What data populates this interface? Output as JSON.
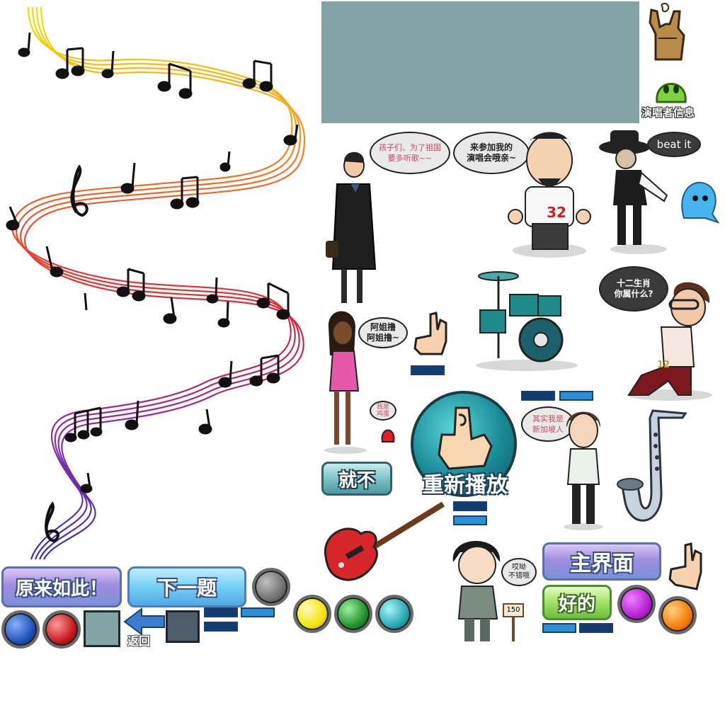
{
  "texts": {
    "singer_info": "演唱者信息",
    "bubble_host": "孩子们、为了祖国\n要多听歌~~",
    "bubble_fan": "来参加我的\n演唱会哦亲~",
    "bubble_beat": "beat it",
    "bubble_zodiac": "十二生肖\n你属什么?",
    "bubble_sister": "阿姐撸\n阿姐撸~",
    "bubble_small": "我是\n鸡蛋",
    "bubble_singapore": "其实我是\n新加坡人",
    "bubble_good": "哎呦\n不错哦",
    "shirt_number": "32",
    "sign_150": "150",
    "jacket_number": "12"
  },
  "buttons": {
    "yuanlai": "原来如此！",
    "next": "下一题",
    "back": "返回",
    "jiubu": "就不",
    "replay": "重新播放",
    "main": "主界面",
    "ok": "好的"
  },
  "colors": {
    "teal_panel": "#83a3a7",
    "orb_blue": "#1e4fb8",
    "orb_red": "#c4141b",
    "orb_gray": "#6e6e6e",
    "orb_yellow": "#f3e300",
    "orb_green": "#1c8f28",
    "orb_cyan": "#23a4b0",
    "orb_purple": "#b21ed0",
    "orb_orange": "#f27a00"
  },
  "icons": [
    "rock-hand-icon",
    "green-face-icon",
    "pointing-hand-icon",
    "back-arrow-icon",
    "drum-kit-icon",
    "saxophone-icon",
    "electric-guitar-icon",
    "music-staff-icon"
  ]
}
